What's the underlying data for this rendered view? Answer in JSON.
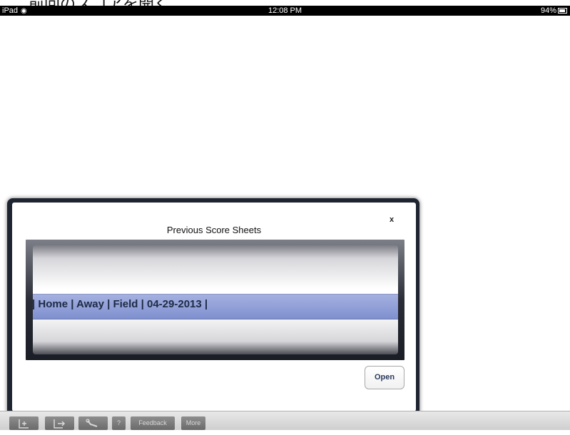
{
  "top_banner": {
    "text": "前回のスコアを開く"
  },
  "status_bar": {
    "device": "iPad",
    "time": "12:08 PM",
    "battery": "94%"
  },
  "dialog": {
    "title": "Previous Score Sheets",
    "close_label": "x",
    "selected_row": "| Home | Away | Field | 04-29-2013 |",
    "open_label": "Open"
  },
  "toolbar": {
    "new_icon": "add-document-icon",
    "export_icon": "export-icon",
    "settings_icon": "wrench-icon",
    "help_label": "?",
    "feedback_label": "Feedback",
    "more_label": "More"
  }
}
